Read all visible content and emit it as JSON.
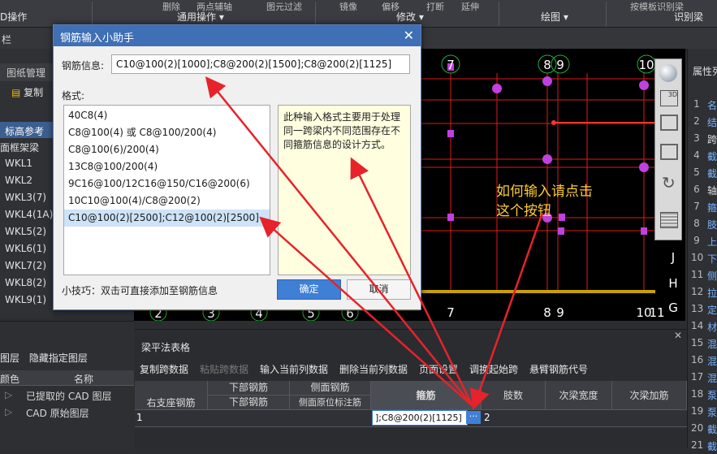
{
  "ribbon": {
    "groups": [
      "D操作",
      "通用操作",
      "修改",
      "绘图",
      "识别梁"
    ],
    "tools": [
      "删除",
      "两点辅轴",
      "图元过滤",
      "镜像",
      "偏移",
      "打断",
      "延伸",
      "按模板识别梁"
    ]
  },
  "subbar": {
    "label": "栏"
  },
  "left_panel": {
    "tab": "图纸管理",
    "copy": "复制",
    "items": [
      "标高参考",
      "面框架梁",
      "WKL1",
      "WKL2",
      "WKL3(7)",
      "WKL4(1A)",
      "WKL5(2)",
      "WKL6(1)",
      "WKL7(2)",
      "WKL8(2)",
      "WKL9(1)"
    ]
  },
  "dialog": {
    "title": "钢筋输入小助手",
    "rebar_label": "钢筋信息:",
    "rebar_value": "C10@100(2)[1000];C8@200(2)[1500];C8@200(2)[1125]",
    "format_label": "格式:",
    "formats": [
      "40C8(4)",
      "C8@100(4) 或 C8@100/200(4)",
      "C8@100(6)/200(4)",
      "13C8@100/200(4)",
      "9C16@100/12C16@150/C16@200(6)",
      "10C10@100(4)/C8@200(2)",
      "C10@100(2)[2500];C12@100(2)[2500]"
    ],
    "selected_index": 6,
    "description": "此种输入格式主要用于处理同一跨梁内不同范围存在不同箍筋信息的设计方式。",
    "tip": "小技巧：双击可直接添加至钢筋信息",
    "ok": "确定",
    "cancel": "取消"
  },
  "hint": {
    "line1": "如何输入请点击",
    "line2": "这个按钮"
  },
  "layer_panel": {
    "toolbar": [
      "图层",
      "隐藏指定图层"
    ],
    "headers": [
      "颜色",
      "名称"
    ],
    "rows": [
      "已提取的 CAD 图层",
      "CAD 原始图层"
    ]
  },
  "table_panel": {
    "title": "梁平法表格",
    "buttons": [
      "复制跨数据",
      "粘贴跨数据",
      "输入当前列数据",
      "删除当前列数据",
      "页面设置",
      "调换起始跨",
      "悬臂钢筋代号"
    ],
    "disabled": [
      1
    ],
    "headers_top": [
      "下部钢筋",
      "侧面钢筋"
    ],
    "headers": [
      "右支座钢筋",
      "下部钢筋",
      "侧面原位标注筋",
      "箍筋",
      "肢数",
      "次梁宽度",
      "次梁加筋"
    ],
    "row_num": "1",
    "cell_value": "];C8@200(2)[1125]",
    "cell_after": "2"
  },
  "canvas": {
    "axis_top": [
      "7",
      "8",
      "9",
      "10"
    ],
    "axis_bottom": [
      "2",
      "3",
      "4",
      "5",
      "6",
      "7",
      "8",
      "9",
      "10",
      "11"
    ],
    "axis_right": [
      "J",
      "H",
      "G"
    ]
  },
  "props": {
    "title": "属性列",
    "rows": [
      {
        "n": "1",
        "t": "名"
      },
      {
        "n": "2",
        "t": "结"
      },
      {
        "n": "3",
        "t": "跨"
      },
      {
        "n": "4",
        "t": "截"
      },
      {
        "n": "5",
        "t": "截"
      },
      {
        "n": "6",
        "t": "轴"
      },
      {
        "n": "7",
        "t": "箍"
      },
      {
        "n": "8",
        "t": "肢"
      },
      {
        "n": "9",
        "t": "上"
      },
      {
        "n": "10",
        "t": "下"
      },
      {
        "n": "11",
        "t": "侧"
      },
      {
        "n": "12",
        "t": "拉"
      },
      {
        "n": "13",
        "t": "定"
      },
      {
        "n": "14",
        "t": "材"
      },
      {
        "n": "15",
        "t": "混"
      },
      {
        "n": "16",
        "t": "混"
      },
      {
        "n": "17",
        "t": "混"
      },
      {
        "n": "18",
        "t": "泵"
      },
      {
        "n": "19",
        "t": "泵"
      },
      {
        "n": "20",
        "t": "截"
      },
      {
        "n": "21",
        "t": "截"
      }
    ]
  },
  "colors": {
    "accent": "#3f6fb5",
    "hint": "#ffcc33",
    "arrow": "#e8222a",
    "selection": "#cde3f7"
  }
}
